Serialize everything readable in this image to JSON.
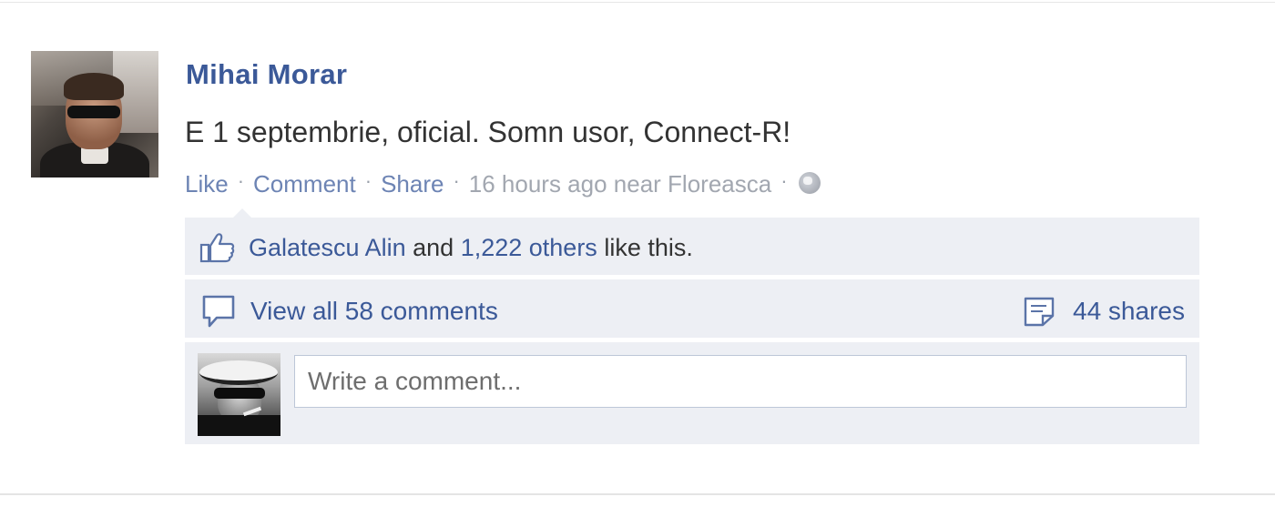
{
  "post": {
    "author": "Mihai Morar",
    "message": "E 1 septembrie, oficial. Somn usor, Connect-R!",
    "actions": {
      "like": "Like",
      "comment": "Comment",
      "share": "Share",
      "separator": "·",
      "time": "16 hours ago near Floreasca",
      "privacy_icon": "globe-icon"
    }
  },
  "ufi": {
    "likes": {
      "icon": "thumbs-up-icon",
      "first_liker": "Galatescu Alin",
      "and": "and",
      "others": "1,222 others",
      "suffix": "like this."
    },
    "comments": {
      "icon": "comment-bubble-icon",
      "view_all": "View all 58 comments"
    },
    "shares": {
      "icon": "share-note-icon",
      "label": "44 shares"
    },
    "compose": {
      "placeholder": "Write a comment...",
      "value": ""
    }
  },
  "colors": {
    "link": "#3b5998",
    "meta_link": "#6d84b4",
    "meta_text": "#9197a3",
    "ufi_background": "#edeff4",
    "text": "#333333"
  }
}
